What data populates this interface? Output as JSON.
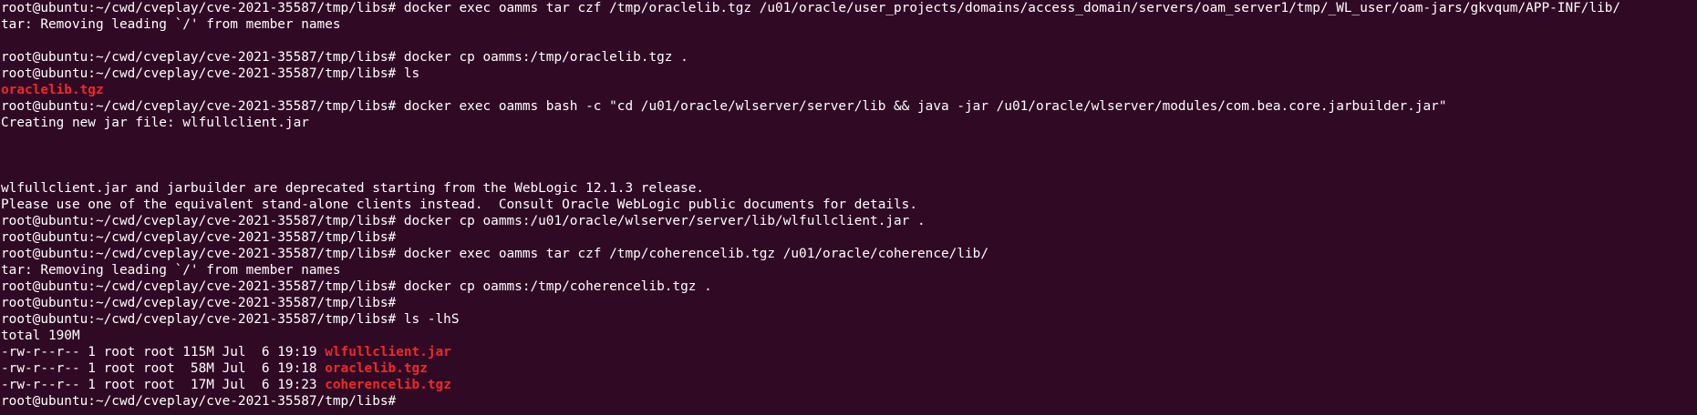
{
  "prompt": "root@ubuntu:~/cwd/cveplay/cve-2021-35587/tmp/libs#",
  "lines": [
    {
      "segments": [
        {
          "text": "root@ubuntu:~/cwd/cveplay/cve-2021-35587/tmp/libs# docker exec oamms tar czf /tmp/oraclelib.tgz /u01/oracle/user_projects/domains/access_domain/servers/oam_server1/tmp/_WL_user/oam-jars/gkvqum/APP-INF/lib/",
          "highlight": false
        }
      ]
    },
    {
      "segments": [
        {
          "text": "tar: Removing leading `/' from member names",
          "highlight": false
        }
      ]
    },
    {
      "segments": [
        {
          "text": "",
          "highlight": false
        }
      ]
    },
    {
      "segments": [
        {
          "text": "root@ubuntu:~/cwd/cveplay/cve-2021-35587/tmp/libs# docker cp oamms:/tmp/oraclelib.tgz .",
          "highlight": false
        }
      ]
    },
    {
      "segments": [
        {
          "text": "root@ubuntu:~/cwd/cveplay/cve-2021-35587/tmp/libs# ls",
          "highlight": false
        }
      ]
    },
    {
      "segments": [
        {
          "text": "oraclelib.tgz",
          "highlight": true
        }
      ]
    },
    {
      "segments": [
        {
          "text": "root@ubuntu:~/cwd/cveplay/cve-2021-35587/tmp/libs# docker exec oamms bash -c \"cd /u01/oracle/wlserver/server/lib && java -jar /u01/oracle/wlserver/modules/com.bea.core.jarbuilder.jar\"",
          "highlight": false
        }
      ]
    },
    {
      "segments": [
        {
          "text": "Creating new jar file: wlfullclient.jar",
          "highlight": false
        }
      ]
    },
    {
      "segments": [
        {
          "text": "",
          "highlight": false
        }
      ]
    },
    {
      "segments": [
        {
          "text": "",
          "highlight": false
        }
      ]
    },
    {
      "segments": [
        {
          "text": "",
          "highlight": false
        }
      ]
    },
    {
      "segments": [
        {
          "text": "wlfullclient.jar and jarbuilder are deprecated starting from the WebLogic 12.1.3 release.",
          "highlight": false
        }
      ]
    },
    {
      "segments": [
        {
          "text": "Please use one of the equivalent stand-alone clients instead.  Consult Oracle WebLogic public documents for details.",
          "highlight": false
        }
      ]
    },
    {
      "segments": [
        {
          "text": "root@ubuntu:~/cwd/cveplay/cve-2021-35587/tmp/libs# docker cp oamms:/u01/oracle/wlserver/server/lib/wlfullclient.jar .",
          "highlight": false
        }
      ]
    },
    {
      "segments": [
        {
          "text": "root@ubuntu:~/cwd/cveplay/cve-2021-35587/tmp/libs#",
          "highlight": false
        }
      ]
    },
    {
      "segments": [
        {
          "text": "root@ubuntu:~/cwd/cveplay/cve-2021-35587/tmp/libs# docker exec oamms tar czf /tmp/coherencelib.tgz /u01/oracle/coherence/lib/",
          "highlight": false
        }
      ]
    },
    {
      "segments": [
        {
          "text": "tar: Removing leading `/' from member names",
          "highlight": false
        }
      ]
    },
    {
      "segments": [
        {
          "text": "root@ubuntu:~/cwd/cveplay/cve-2021-35587/tmp/libs# docker cp oamms:/tmp/coherencelib.tgz .",
          "highlight": false
        }
      ]
    },
    {
      "segments": [
        {
          "text": "root@ubuntu:~/cwd/cveplay/cve-2021-35587/tmp/libs#",
          "highlight": false
        }
      ]
    },
    {
      "segments": [
        {
          "text": "root@ubuntu:~/cwd/cveplay/cve-2021-35587/tmp/libs# ls -lhS",
          "highlight": false
        }
      ]
    },
    {
      "segments": [
        {
          "text": "total 190M",
          "highlight": false
        }
      ]
    },
    {
      "segments": [
        {
          "text": "-rw-r--r-- 1 root root 115M Jul  6 19:19 ",
          "highlight": false
        },
        {
          "text": "wlfullclient.jar",
          "highlight": true
        }
      ]
    },
    {
      "segments": [
        {
          "text": "-rw-r--r-- 1 root root  58M Jul  6 19:18 ",
          "highlight": false
        },
        {
          "text": "oraclelib.tgz",
          "highlight": true
        }
      ]
    },
    {
      "segments": [
        {
          "text": "-rw-r--r-- 1 root root  17M Jul  6 19:23 ",
          "highlight": false
        },
        {
          "text": "coherencelib.tgz",
          "highlight": true
        }
      ]
    },
    {
      "segments": [
        {
          "text": "root@ubuntu:~/cwd/cveplay/cve-2021-35587/tmp/libs#",
          "highlight": false
        }
      ]
    }
  ],
  "colors": {
    "background": "#300a24",
    "text": "#ffffff",
    "archive_highlight": "#ef2929"
  }
}
